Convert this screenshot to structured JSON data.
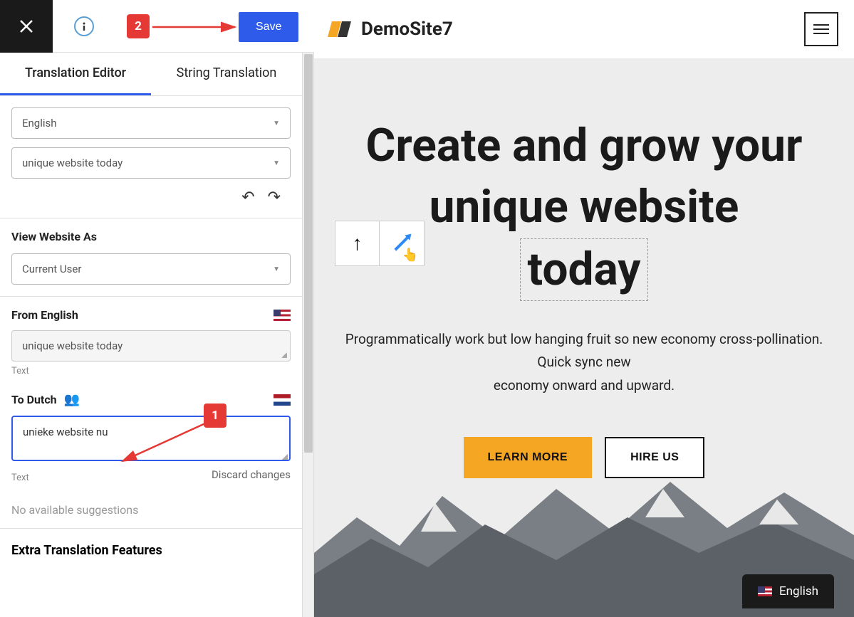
{
  "topbar": {
    "save_label": "Save"
  },
  "tabs": {
    "editor": "Translation Editor",
    "string": "String Translation"
  },
  "selectors": {
    "language": "English",
    "string": "unique website today"
  },
  "view_as": {
    "label": "View Website As",
    "value": "Current User"
  },
  "from": {
    "label": "From English",
    "value": "unique website today",
    "hint": "Text"
  },
  "to": {
    "label": "To Dutch",
    "value": "unieke website nu",
    "hint": "Text",
    "discard": "Discard changes"
  },
  "suggestions": "No available suggestions",
  "extra_title": "Extra Translation Features",
  "preview": {
    "site_name": "DemoSite7",
    "heading_line1": "Create and grow your",
    "heading_line2": "unique website",
    "heading_line3": "today",
    "sub_line1": "Programmatically work but low hanging fruit so new economy cross-pollination.",
    "sub_line2": "Quick sync new",
    "sub_line3": "economy onward and upward.",
    "cta_primary": "LEARN MORE",
    "cta_secondary": "HIRE US",
    "lang_switch": "English"
  },
  "callouts": {
    "one": "1",
    "two": "2"
  }
}
